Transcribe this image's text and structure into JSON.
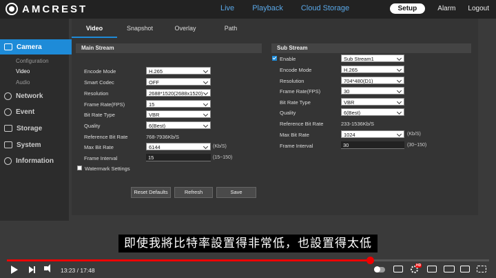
{
  "brand": "AMCREST",
  "topnav": [
    "Live",
    "Playback",
    "Cloud Storage"
  ],
  "topright": {
    "setup": "Setup",
    "alarm": "Alarm",
    "logout": "Logout"
  },
  "sidebar": {
    "camera": "Camera",
    "sub": [
      "Configuration",
      "Video",
      "Audio"
    ],
    "items": [
      "Network",
      "Event",
      "Storage",
      "System",
      "Information"
    ]
  },
  "tabs": [
    "Video",
    "Snapshot",
    "Overlay",
    "Path"
  ],
  "main_stream": {
    "title": "Main Stream",
    "encode_mode_label": "Encode Mode",
    "encode_mode": "H.265",
    "smart_codec_label": "Smart Codec",
    "smart_codec": "OFF",
    "resolution_label": "Resolution",
    "resolution": "2688*1520(2688x1520)",
    "fps_label": "Frame Rate(FPS)",
    "fps": "15",
    "bitrate_type_label": "Bit Rate Type",
    "bitrate_type": "VBR",
    "quality_label": "Quality",
    "quality": "6(Best)",
    "ref_bitrate_label": "Reference Bit Rate",
    "ref_bitrate": "768-7936Kb/S",
    "max_bitrate_label": "Max Bit Rate",
    "max_bitrate": "6144",
    "max_bitrate_unit": "(Kb/S)",
    "frame_interval_label": "Frame Interval",
    "frame_interval": "15",
    "frame_interval_range": "(15~150)",
    "watermark_label": "Watermark Settings"
  },
  "sub_stream": {
    "title": "Sub Stream",
    "enable_label": "Enable",
    "stream": "Sub Stream1",
    "encode_mode_label": "Encode Mode",
    "encode_mode": "H.265",
    "resolution_label": "Resolution",
    "resolution": "704*480(D1)",
    "fps_label": "Frame Rate(FPS)",
    "fps": "30",
    "bitrate_type_label": "Bit Rate Type",
    "bitrate_type": "VBR",
    "quality_label": "Quality",
    "quality": "6(Best)",
    "ref_bitrate_label": "Reference Bit Rate",
    "ref_bitrate": "233-1536Kb/S",
    "max_bitrate_label": "Max Bit Rate",
    "max_bitrate": "1024",
    "max_bitrate_unit": "(Kb/S)",
    "frame_interval_label": "Frame Interval",
    "frame_interval": "30",
    "frame_interval_range": "(30~150)"
  },
  "buttons": {
    "reset": "Reset Defaults",
    "refresh": "Refresh",
    "save": "Save"
  },
  "subtitle": "即使我將比特率設置得非常低，也設置得太低",
  "player": {
    "time": "13:23 / 17:48",
    "progress": 0.753
  },
  "colors": {
    "accent": "#1e8bd8",
    "progress": "#ee0000"
  }
}
